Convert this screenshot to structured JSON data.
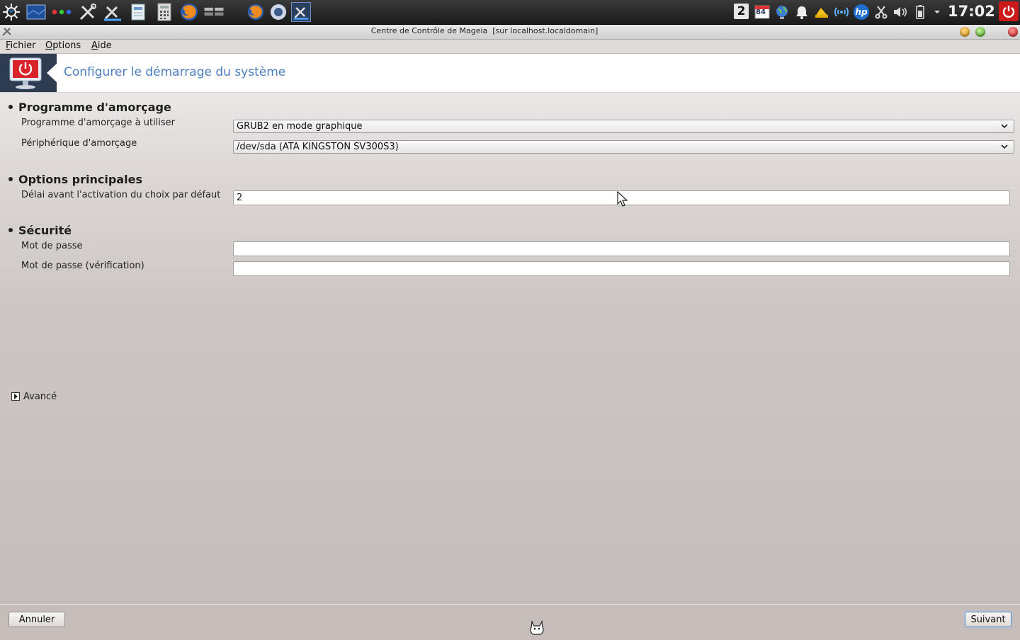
{
  "panel": {
    "desktop_number": "2",
    "clock": "17:02",
    "calendar_badge": "84",
    "icons": [
      "kde-menu-icon",
      "desktop-icon",
      "color-dots-icon",
      "tools-icon",
      "mcc-icon",
      "file-manager-icon",
      "calculator-icon",
      "firefox-icon",
      "window-list-icon",
      "firefox-task-icon",
      "network-task-icon",
      "mcc-task-icon"
    ],
    "tray_icons": [
      "calendar-icon",
      "globe-icon",
      "bell-icon",
      "update-icon",
      "wifi-icon",
      "hp-icon",
      "scissors-icon",
      "volume-icon",
      "battery-icon",
      "tray-menu-icon",
      "power-icon"
    ]
  },
  "window": {
    "title": "Centre de Contrôle de Mageia  [sur localhost.localdomain]"
  },
  "menubar": {
    "items": [
      {
        "mnemonic": "F",
        "rest": "ichier"
      },
      {
        "mnemonic": "O",
        "rest": "ptions"
      },
      {
        "mnemonic": "A",
        "rest": "ide"
      }
    ]
  },
  "header": {
    "title": "Configurer le démarrage du système"
  },
  "sections": {
    "bootloader": {
      "title": "Programme d'amorçage",
      "loader_label": "Programme d'amorçage à utiliser",
      "loader_value": "GRUB2 en mode graphique",
      "device_label": "Périphérique d'amorçage",
      "device_value": "/dev/sda (ATA KINGSTON SV300S3)"
    },
    "main_options": {
      "title": "Options principales",
      "delay_label": "Délai avant l'activation du choix par défaut",
      "delay_value": "2"
    },
    "security": {
      "title": "Sécurité",
      "password_label": "Mot de passe",
      "password_value": "",
      "password_verify_label": "Mot de passe (vérification)",
      "password_verify_value": ""
    },
    "advanced": {
      "label": "Avancé"
    }
  },
  "footer": {
    "cancel_label": "Annuler",
    "next_label": "Suivant"
  },
  "colors": {
    "accent": "#4a7fbf",
    "background": "#c6bdbb",
    "header_logo_bg": "#2e3c52",
    "power_red": "#cc1a1a"
  }
}
